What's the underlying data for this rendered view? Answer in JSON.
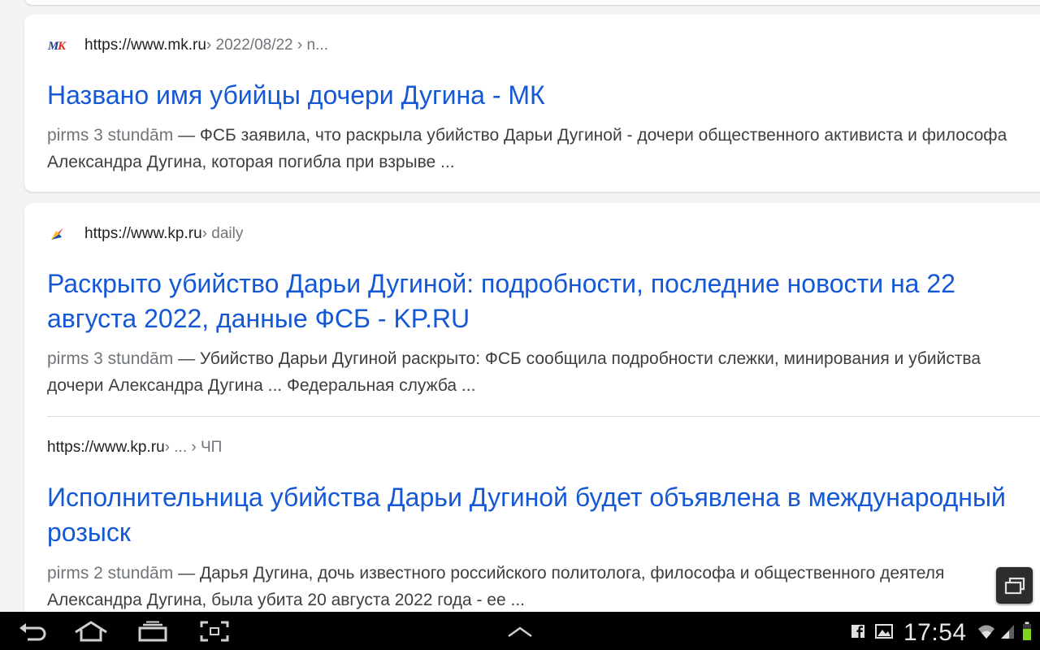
{
  "results": [
    {
      "url": "https://www.mk.ru",
      "crumb": " › 2022/08/22 › n...",
      "title": "Названо имя убийцы дочери Дугина - МК",
      "age": "pirms 3 stundām",
      "snippet": " — ФСБ заявила, что раскрыла убийство Дарьи Дугиной - дочери общественного активиста и философа Александра Дугина, которая погибла при взрыве ...",
      "favicon": "mk-logo-icon"
    },
    {
      "url": "https://www.kp.ru",
      "crumb": " › daily",
      "title": "Раскрыто убийство Дарьи Дугиной: подробности, последние новости на 22 августа 2022, данные ФСБ - KP.RU",
      "age": "pirms 3 stundām",
      "snippet": " — Убийство Дарьи Дугиной раскрыто: ФСБ сообщила подробности слежки, минирования и убийства дочери Александра Дугина ... Федеральная служба ...",
      "favicon": "kp-logo-icon"
    },
    {
      "url": "https://www.kp.ru",
      "crumb": " › ... › ЧП",
      "title": "Исполнительница убийства Дарьи Дугиной будет объявлена в международный розыск",
      "age": "pirms 2 stundām",
      "snippet": " — Дарья Дугина, дочь известного российского политолога, философа и общественного деятеля Александра Дугина, была убита 20 августа 2022 года - ее ..."
    }
  ],
  "statusbar": {
    "time": "17:54"
  },
  "colors": {
    "link": "#1558d6",
    "background": "#f1f3f4",
    "navbar": "#000000"
  }
}
